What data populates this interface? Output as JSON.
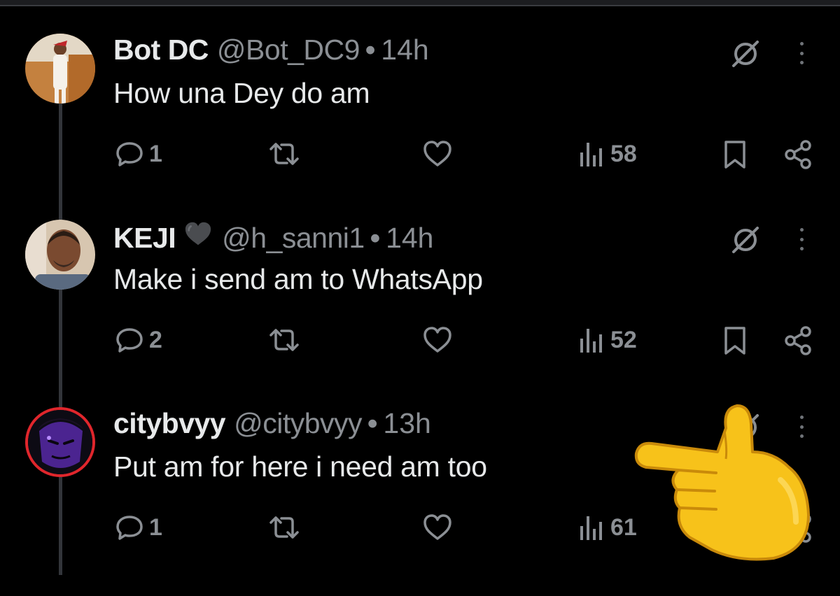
{
  "tweets": [
    {
      "name": "Bot DC",
      "handle": "@Bot_DC9",
      "separator": "•",
      "time": "14h",
      "text": "How una Dey do am",
      "replies": "1",
      "views": "58",
      "avatar": "photo-man-santa-hat"
    },
    {
      "name": "KEJI",
      "name_emoji": "black-heart",
      "handle": "@h_sanni1",
      "separator": "•",
      "time": "14h",
      "text": "Make i send am to WhatsApp",
      "replies": "2",
      "views": "52",
      "avatar": "photo-man-portrait"
    },
    {
      "name": "citybvyy",
      "handle": "@citybvyy",
      "separator": "•",
      "time": "13h",
      "text": "Put am for here i need am too",
      "replies": "1",
      "views": "61",
      "avatar": "purple-cartoon-face"
    }
  ],
  "icons": [
    "reply-icon",
    "retweet-icon",
    "like-icon",
    "views-icon",
    "bookmark-icon",
    "share-icon",
    "grok-icon",
    "more-icon"
  ],
  "overlay": {
    "emoji": "backhand-index-pointing-left"
  },
  "colors": {
    "background": "#000000",
    "text": "#e7e9ea",
    "muted": "#8b8f94",
    "thread": "#32353a"
  }
}
